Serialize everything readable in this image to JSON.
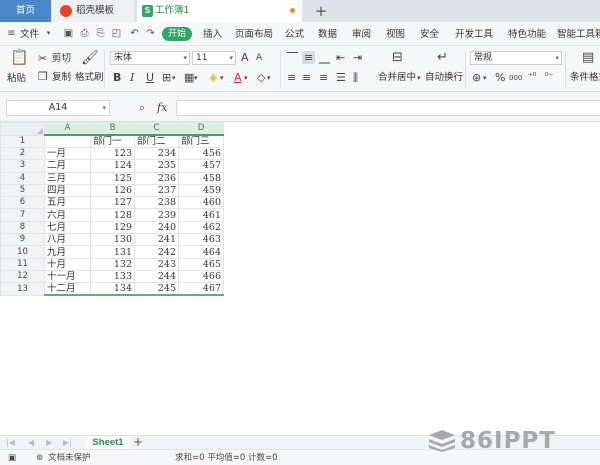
{
  "tabs": {
    "home": "首页",
    "templates": "稻壳模板",
    "workbook": "工作簿1",
    "workbook_icon": "S",
    "new_tab": "+"
  },
  "menu": {
    "file": "文件",
    "start": "开始",
    "items": [
      "插入",
      "页面布局",
      "公式",
      "数据",
      "审阅",
      "视图",
      "安全",
      "开发工具",
      "特色功能",
      "智能工具箱"
    ]
  },
  "ribbon": {
    "paste": "粘贴",
    "cut": "剪切",
    "copy": "复制",
    "format_painter": "格式刷",
    "font_name": "宋体",
    "font_size": "11",
    "grow_font": "A",
    "shrink_font": "A",
    "bold": "B",
    "italic": "I",
    "underline": "U",
    "font_color_glyph": "A",
    "merge_center": "合并居中",
    "wrap_text": "自动换行",
    "number_format": "常规",
    "percent": "%",
    "thousands": "000",
    "conditional_format": "条件格式"
  },
  "formula_bar": {
    "cell_ref": "A14",
    "fx": "fx",
    "value": ""
  },
  "grid": {
    "columns": [
      "A",
      "B",
      "C",
      "D"
    ],
    "rows": [
      [
        "1",
        "",
        "部门一",
        "部门二",
        "部门三"
      ],
      [
        "2",
        "一月",
        "123",
        "234",
        "456"
      ],
      [
        "3",
        "二月",
        "124",
        "235",
        "457"
      ],
      [
        "4",
        "三月",
        "125",
        "236",
        "458"
      ],
      [
        "5",
        "四月",
        "126",
        "237",
        "459"
      ],
      [
        "6",
        "五月",
        "127",
        "238",
        "460"
      ],
      [
        "7",
        "六月",
        "128",
        "239",
        "461"
      ],
      [
        "8",
        "七月",
        "129",
        "240",
        "462"
      ],
      [
        "9",
        "八月",
        "130",
        "241",
        "463"
      ],
      [
        "10",
        "九月",
        "131",
        "242",
        "464"
      ],
      [
        "11",
        "十月",
        "132",
        "243",
        "465"
      ],
      [
        "12",
        "十一月",
        "133",
        "244",
        "466"
      ],
      [
        "13",
        "十二月",
        "134",
        "245",
        "467"
      ]
    ]
  },
  "sheets": {
    "active": "Sheet1",
    "add": "+"
  },
  "status": {
    "protection": "文档未保护",
    "summary": "求和=0  平均值=0  计数=0"
  },
  "watermark": "86IPPT",
  "colors": {
    "accent_green": "#2ea862",
    "home_tab": "#4a86c8",
    "template_logo": "#e2452d"
  }
}
